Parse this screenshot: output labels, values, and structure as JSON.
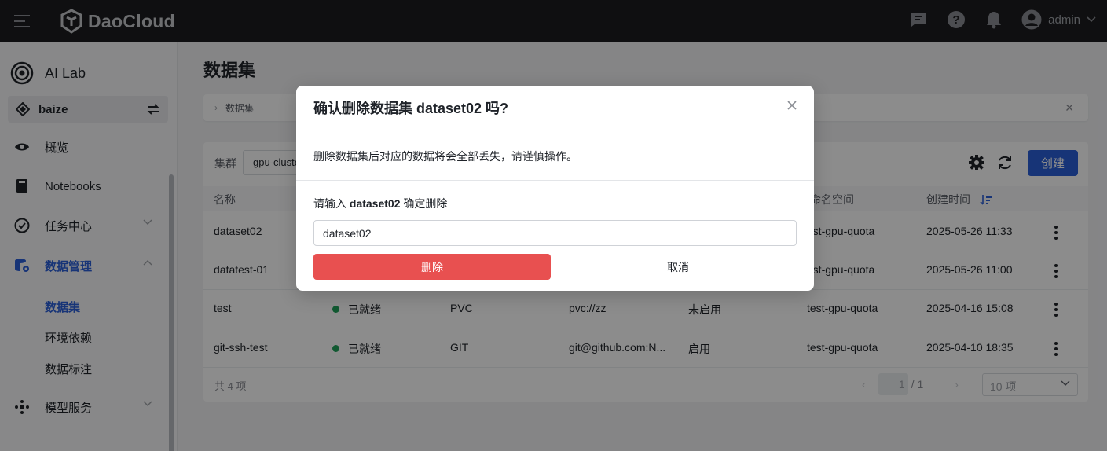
{
  "topbar": {
    "logo_text": "DaoCloud",
    "user_name": "admin"
  },
  "sidebar": {
    "brand": "AI Lab",
    "workspace": "baize",
    "items": [
      {
        "label": "概览",
        "icon": "eye-icon"
      },
      {
        "label": "Notebooks",
        "icon": "notebook-icon"
      },
      {
        "label": "任务中心",
        "icon": "task-check-icon"
      },
      {
        "label": "数据管理",
        "icon": "database-icon"
      },
      {
        "label": "模型服务",
        "icon": "model-service-icon"
      }
    ],
    "sub_items": [
      {
        "label": "数据集"
      },
      {
        "label": "环境依赖"
      },
      {
        "label": "数据标注"
      }
    ]
  },
  "page": {
    "title": "数据集",
    "breadcrumb": "数据集"
  },
  "toolbar": {
    "cluster_label": "集群",
    "cluster_value": "gpu-cluster",
    "create_label": "创建"
  },
  "table": {
    "columns": [
      "名称",
      "命名空间",
      "创建时间"
    ],
    "rows": [
      {
        "name": "dataset02",
        "status": "",
        "type": "",
        "uri": "",
        "sync": "",
        "namespace": "test-gpu-quota",
        "created": "2025-05-26 11:33"
      },
      {
        "name": "datatest-01",
        "status": "",
        "type": "",
        "uri": "",
        "sync": "",
        "namespace": "test-gpu-quota",
        "created": "2025-05-26 11:00"
      },
      {
        "name": "test",
        "status": "已就绪",
        "type": "PVC",
        "uri": "pvc://zz",
        "sync": "未启用",
        "namespace": "test-gpu-quota",
        "created": "2025-04-16 15:08"
      },
      {
        "name": "git-ssh-test",
        "status": "已就绪",
        "type": "GIT",
        "uri": "git@github.com:N...",
        "sync": "启用",
        "namespace": "test-gpu-quota",
        "created": "2025-04-10 18:35"
      }
    ],
    "total": "共 4 项",
    "page": "1",
    "page_total": "/ 1",
    "page_size": "10 项"
  },
  "modal": {
    "title": "确认删除数据集 dataset02 吗?",
    "warning": "删除数据集后对应的数据将会全部丢失，请谨慎操作。",
    "confirm_prefix": "请输入 ",
    "confirm_name": "dataset02",
    "confirm_suffix": " 确定删除",
    "input_value": "dataset02",
    "delete_label": "删除",
    "cancel_label": "取消"
  },
  "colors": {
    "primary": "#2b5fd9",
    "danger": "#e85050",
    "status_ready": "#1fa35a",
    "topbar_bg": "#1c1c1f"
  }
}
